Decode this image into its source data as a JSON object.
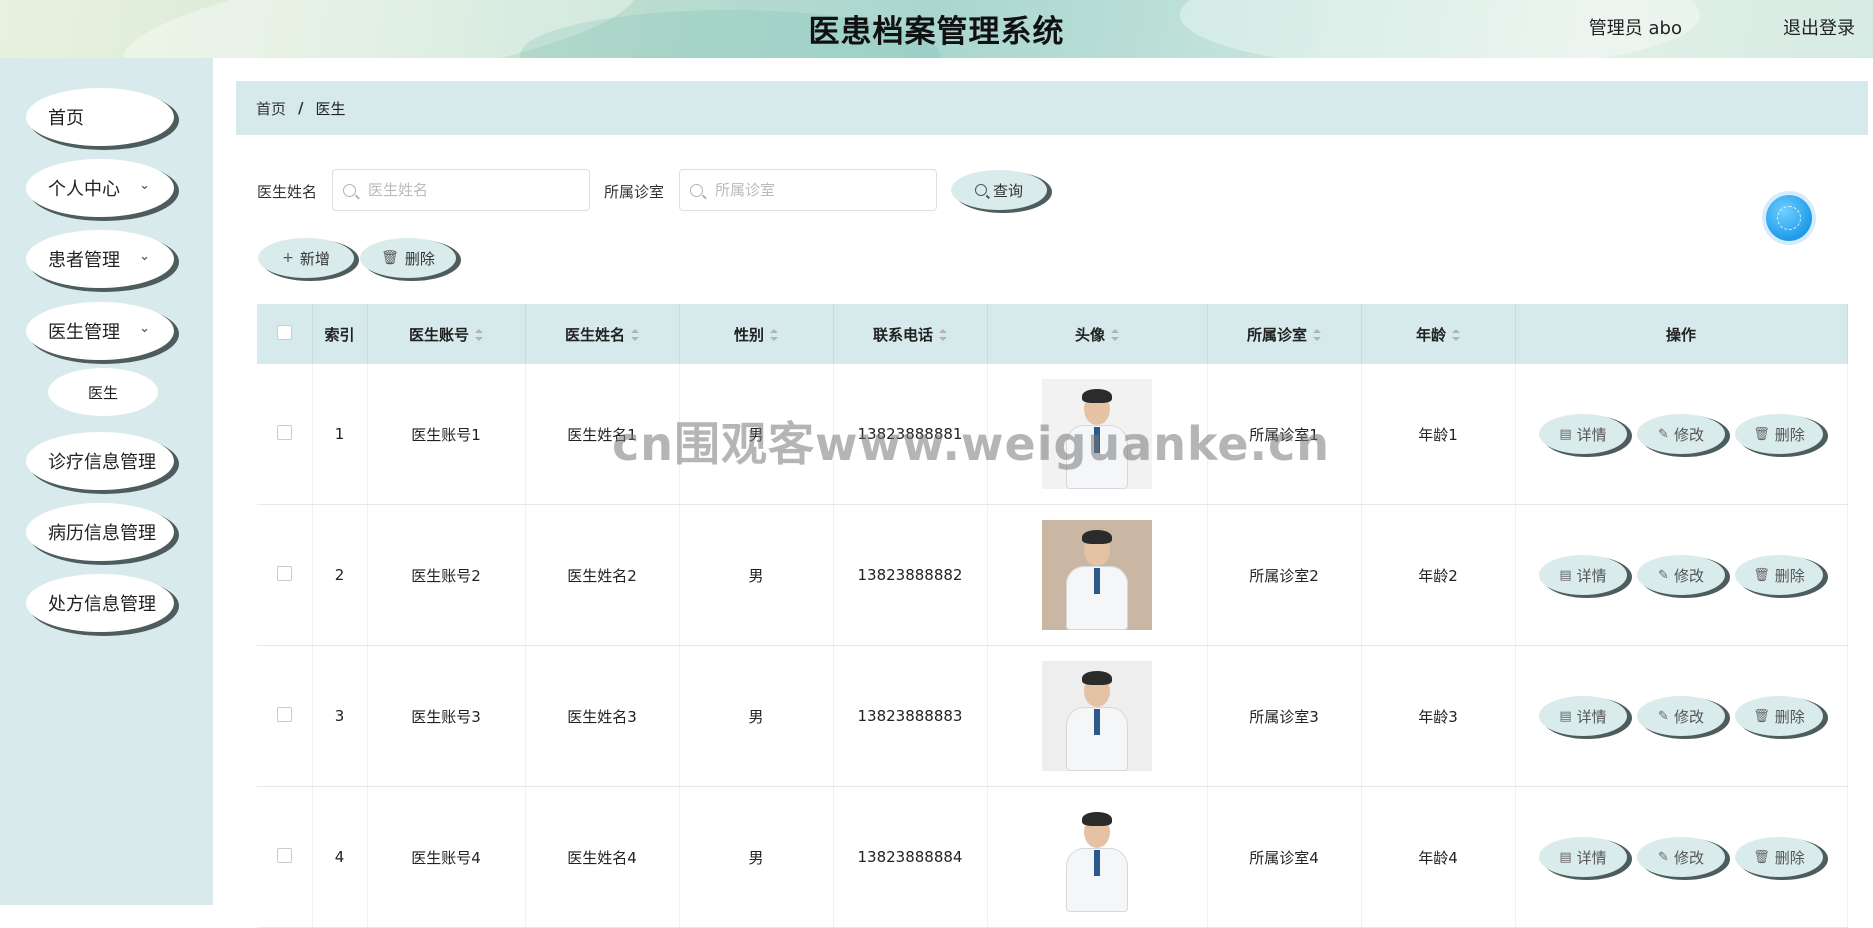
{
  "header": {
    "title": "医患档案管理系统",
    "user": "管理员 abo",
    "logout": "退出登录"
  },
  "sidebar": {
    "items": [
      {
        "label": "首页",
        "chevron": false
      },
      {
        "label": "个人中心",
        "chevron": true
      },
      {
        "label": "患者管理",
        "chevron": true
      },
      {
        "label": "医生管理",
        "chevron": true
      },
      {
        "label": "诊疗信息管理",
        "chevron": false
      },
      {
        "label": "病历信息管理",
        "chevron": false
      },
      {
        "label": "处方信息管理",
        "chevron": false
      }
    ],
    "sub_item": "医生"
  },
  "breadcrumb": {
    "home": "首页",
    "separator": "/",
    "current": "医生"
  },
  "search": {
    "name_label": "医生姓名",
    "name_placeholder": "医生姓名",
    "clinic_label": "所属诊室",
    "clinic_placeholder": "所属诊室",
    "query_button": "查询"
  },
  "toolbar": {
    "add_button": "新增",
    "delete_button": "删除"
  },
  "table": {
    "headers": [
      "索引",
      "医生账号",
      "医生姓名",
      "性别",
      "联系电话",
      "头像",
      "所属诊室",
      "年龄",
      "操作"
    ],
    "rows": [
      {
        "index": "1",
        "account": "医生账号1",
        "name": "医生姓名1",
        "gender": "男",
        "phone": "13823888881",
        "clinic": "所属诊室1",
        "age": "年龄1",
        "avatar_bg": "#f2f2f2"
      },
      {
        "index": "2",
        "account": "医生账号2",
        "name": "医生姓名2",
        "gender": "男",
        "phone": "13823888882",
        "clinic": "所属诊室2",
        "age": "年龄2",
        "avatar_bg": "#c9b7a3"
      },
      {
        "index": "3",
        "account": "医生账号3",
        "name": "医生姓名3",
        "gender": "男",
        "phone": "13823888883",
        "clinic": "所属诊室3",
        "age": "年龄3",
        "avatar_bg": "#eeeeee"
      },
      {
        "index": "4",
        "account": "医生账号4",
        "name": "医生姓名4",
        "gender": "男",
        "phone": "13823888884",
        "clinic": "所属诊室4",
        "age": "年龄4",
        "avatar_bg": "#ffffff"
      }
    ],
    "actions": {
      "detail": "详情",
      "edit": "修改",
      "delete": "删除"
    }
  },
  "watermark": "cn围观客www.weiguanke.cn",
  "icons": {
    "add": "plus-icon",
    "delete": "trash-icon",
    "search": "search-icon",
    "detail": "document-icon",
    "edit": "pencil-icon",
    "chevron": "chevron-down-icon"
  }
}
